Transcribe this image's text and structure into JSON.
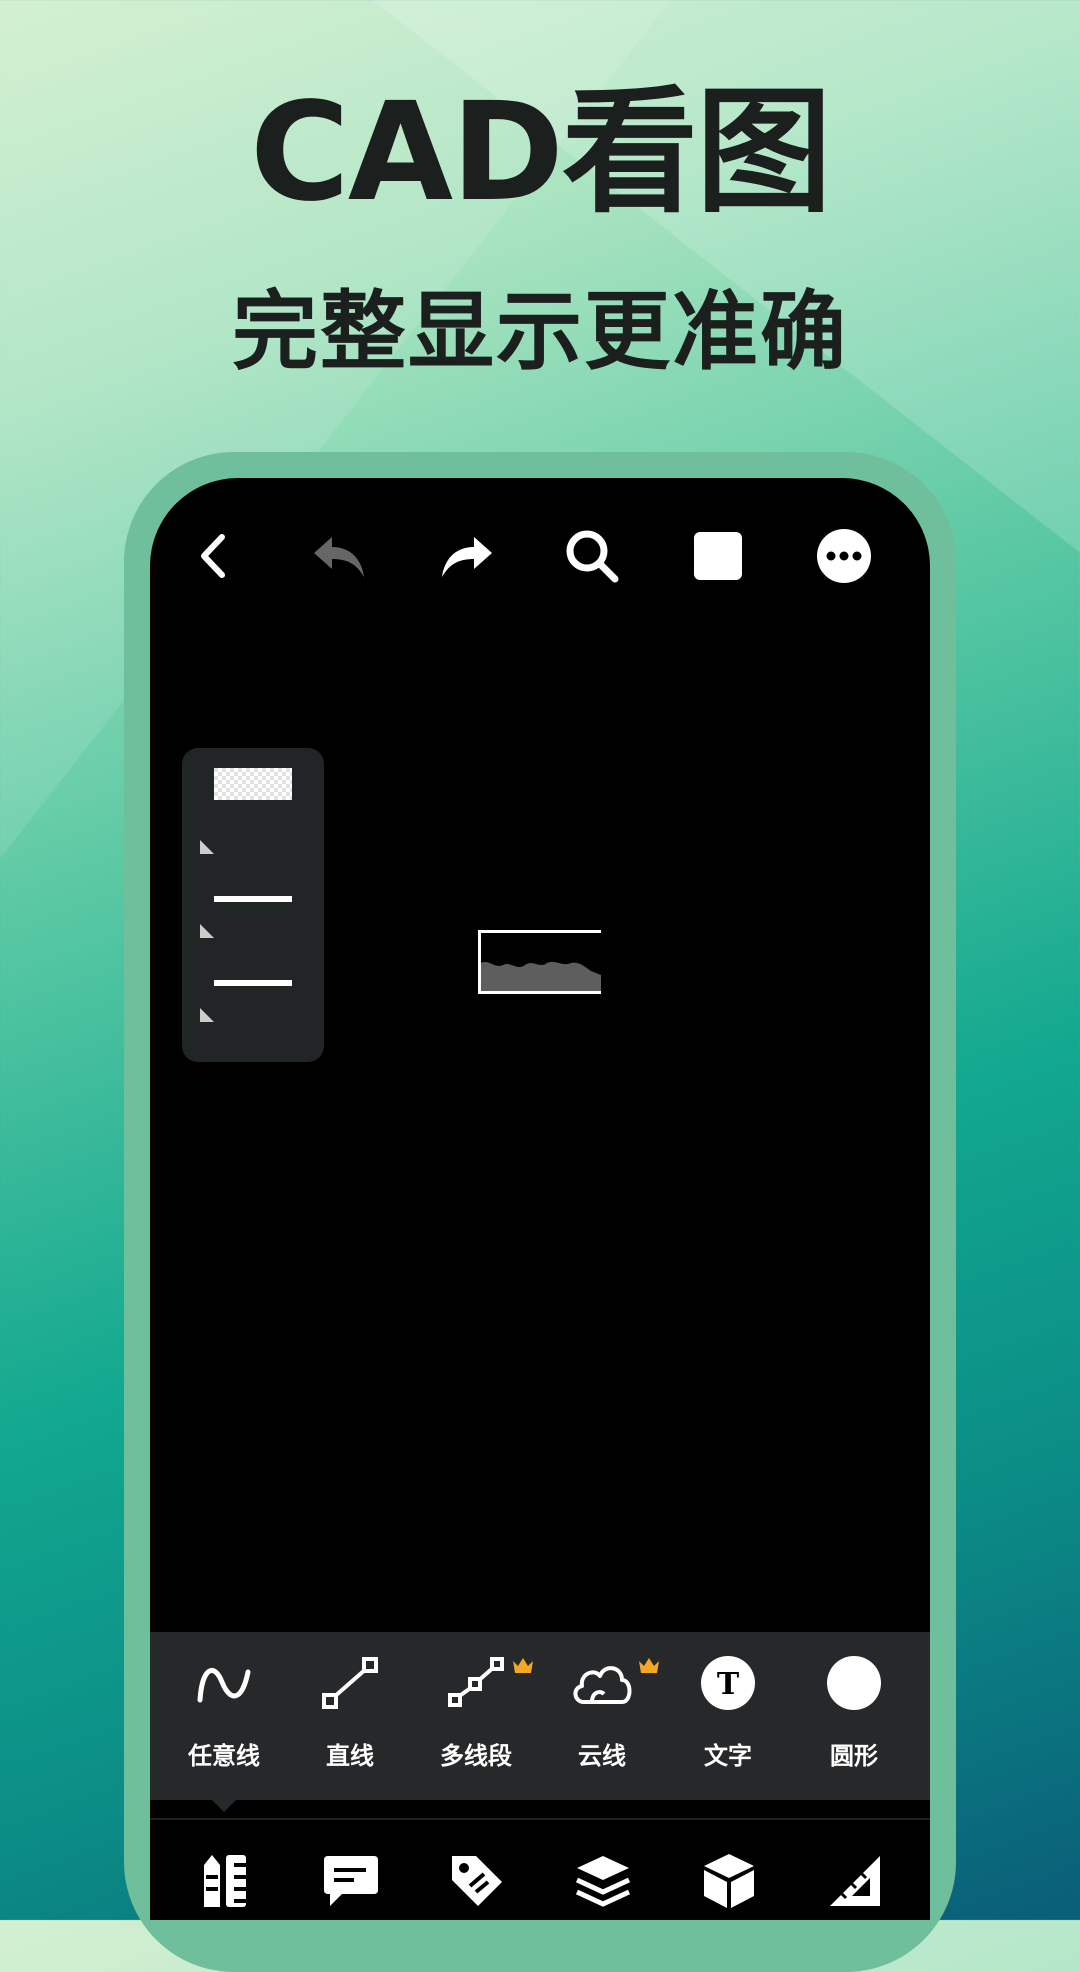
{
  "promo": {
    "title": "CAD看图",
    "subtitle": "完整显示更准确"
  },
  "toolbar": {
    "icons": [
      "back-icon",
      "undo-icon",
      "redo-icon",
      "search-icon",
      "square-icon",
      "more-icon"
    ]
  },
  "layers": {
    "rows": [
      "swatch-layer",
      "line-layer",
      "line-layer"
    ]
  },
  "tools": {
    "items": [
      {
        "label": "任意线",
        "icon": "freehand-icon",
        "premium": false
      },
      {
        "label": "直线",
        "icon": "line-icon",
        "premium": false
      },
      {
        "label": "多线段",
        "icon": "polyline-icon",
        "premium": true
      },
      {
        "label": "云线",
        "icon": "cloud-icon",
        "premium": true
      },
      {
        "label": "文字",
        "icon": "text-icon",
        "premium": false
      },
      {
        "label": "圆形",
        "icon": "circle-icon",
        "premium": false
      }
    ],
    "text_icon_glyph": "T",
    "premium_color": "#f5a623"
  },
  "bottom_nav": {
    "icons": [
      "markup-tools-icon",
      "comment-icon",
      "tag-icon",
      "layers-icon",
      "3d-box-icon",
      "measure-icon"
    ]
  },
  "colors": {
    "title": "#1b1f1e",
    "frame": "#6fbf9c",
    "panel": "#262829"
  }
}
